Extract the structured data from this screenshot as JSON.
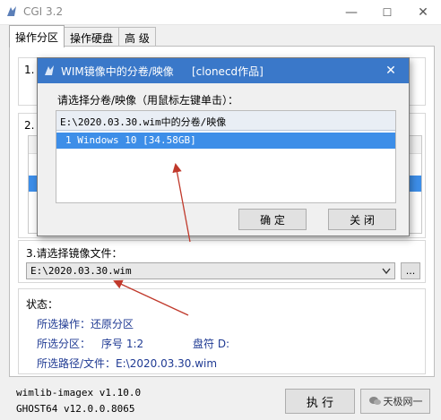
{
  "window": {
    "title": "CGI 3.2",
    "minimize": "—",
    "maximize": "☐",
    "close": "✕"
  },
  "tabs": [
    {
      "label": "操作分区"
    },
    {
      "label": "操作硬盘"
    },
    {
      "label": "高 级"
    }
  ],
  "sections": {
    "s1": "1.",
    "s2": "2.",
    "s3": {
      "label": "3.请选择镜像文件：",
      "value": "E:\\2020.03.30.wim",
      "browse": "..."
    }
  },
  "dialog": {
    "title": "WIM镜像中的分卷/映像",
    "subtitle": "[clonecd作品]",
    "close": "✕",
    "prompt": "请选择分卷/映像（用鼠标左键单击）：",
    "header": "E:\\2020.03.30.wim中的分卷/映像",
    "items": [
      {
        "label": "1  Windows 10  [34.58GB]"
      }
    ],
    "ok": "确 定",
    "cancel": "关 闭"
  },
  "status": {
    "label": "状态：",
    "op": "所选操作：还原分区",
    "part_label": "所选分区：",
    "part_no": "序号 1:2",
    "drive": "盘符 D:",
    "path": "所选路径/文件：E:\\2020.03.30.wim"
  },
  "footer": {
    "v1": "wimlib-imagex v1.10.0",
    "v2": "GHOST64 v12.0.0.8065",
    "run": "执 行",
    "watermark": "天极网一"
  },
  "colors": {
    "accent": "#3a78c9",
    "selection": "#3d8ee8",
    "arrow": "#c0392b",
    "status_text": "#1f3a93"
  }
}
